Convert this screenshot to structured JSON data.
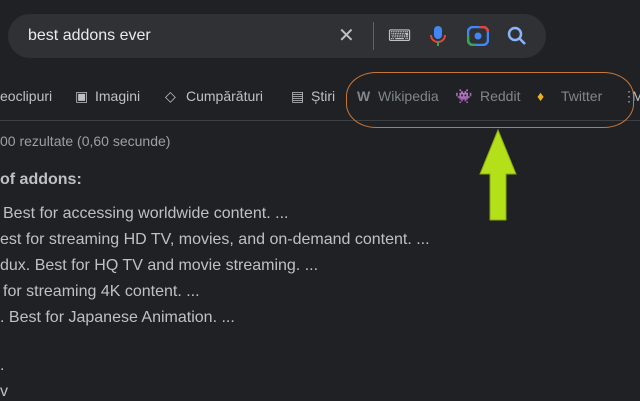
{
  "search": {
    "query": "best addons ever"
  },
  "tabs": [
    {
      "label": "eoclipuri"
    },
    {
      "label": "Imagini"
    },
    {
      "label": "Cumpărături"
    },
    {
      "label": "Știri"
    },
    {
      "label": "Wikipedia"
    },
    {
      "label": "Reddit"
    },
    {
      "label": "Twitter"
    },
    {
      "label": "M"
    }
  ],
  "stats": "00 rezultate (0,60 secunde)",
  "result": {
    "heading": "of addons:",
    "items": [
      "Best for accessing worldwide content. ...",
      "est for streaming HD TV, movies, and on-demand content. ...",
      "dux. Best for HQ TV and movie streaming. ...",
      "for streaming 4K content. ...",
      ". Best for Japanese Animation. ..."
    ],
    "extra": [
      ".",
      "v"
    ]
  },
  "colors": {
    "annotation_oval": "#c8773a",
    "arrow": "#b4e01a"
  }
}
